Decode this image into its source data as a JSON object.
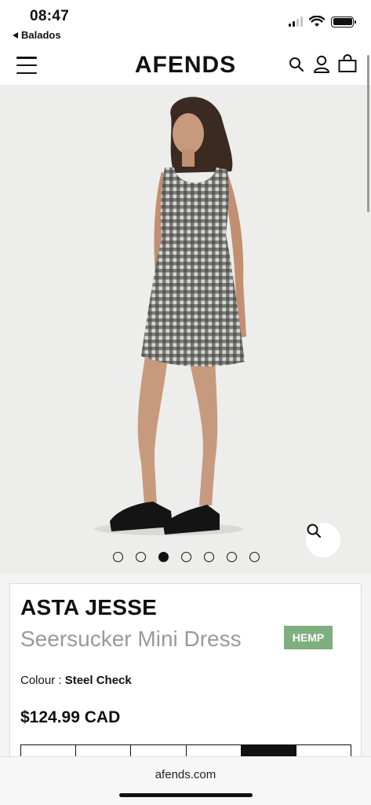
{
  "status_bar": {
    "time": "08:47",
    "back_app": "Balados",
    "icons": [
      "signal-icon",
      "wifi-icon",
      "battery-icon"
    ]
  },
  "header": {
    "logo": "AFENDS",
    "icons": [
      "menu-icon",
      "search-icon",
      "account-icon",
      "bag-icon"
    ]
  },
  "gallery": {
    "image_count": 7,
    "active_index": 3,
    "zoom_icon": "zoom-icon"
  },
  "product": {
    "brand": "ASTA JESSE",
    "name": "Seersucker Mini Dress",
    "badge": "HEMP",
    "colour_label": "Colour :",
    "colour_value": "Steel Check",
    "price": "$124.99 CAD",
    "sizes_selected_index": 4
  },
  "browser": {
    "url": "afends.com"
  },
  "colors": {
    "badge": "#7fae7f",
    "hero_bg": "#ededeb",
    "subtitle": "#9a9a9a"
  }
}
